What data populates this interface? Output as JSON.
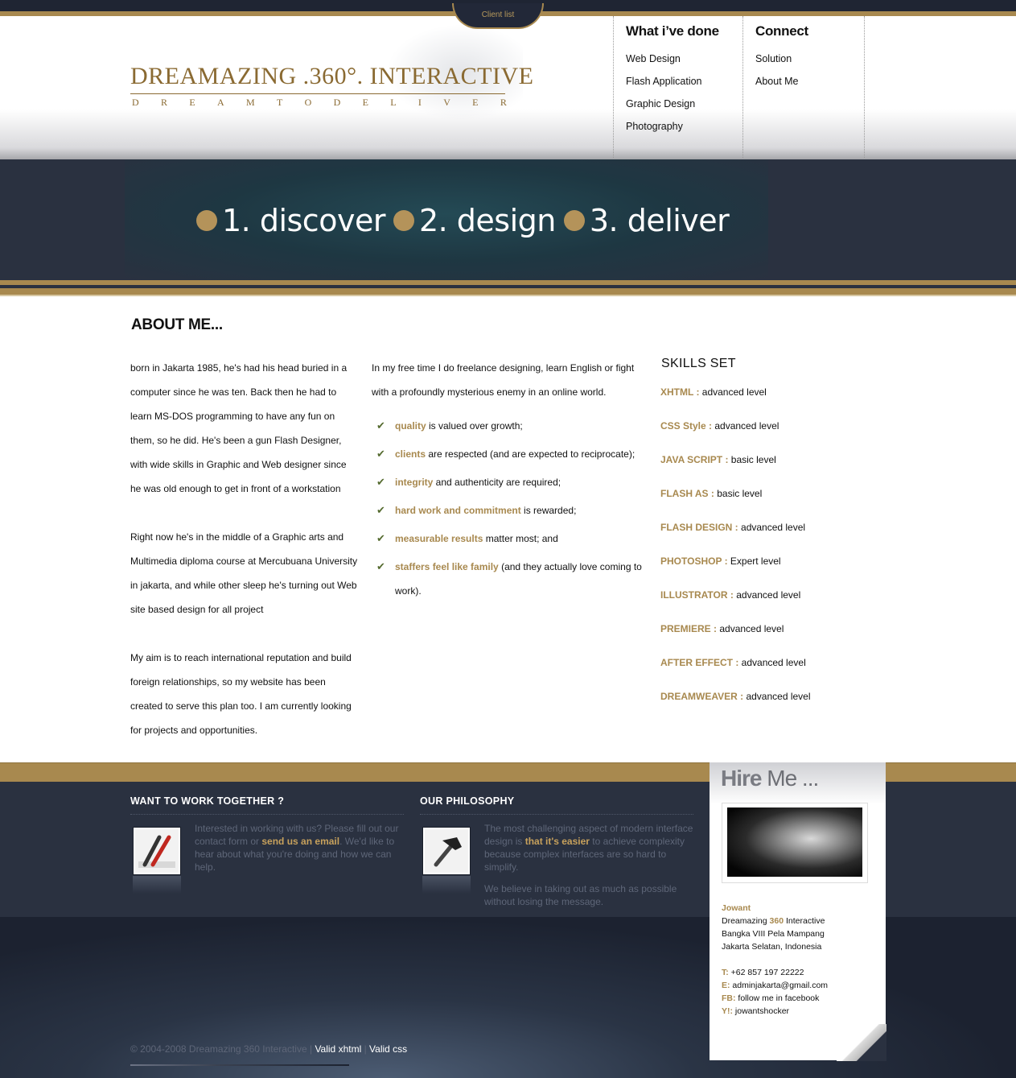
{
  "top": {
    "client_tab": "Client list"
  },
  "logo": {
    "title": "DREAMAZING .360°. INTERACTIVE",
    "tagline": [
      "D",
      "R",
      "E",
      "A",
      "M",
      "T",
      "O",
      "D",
      "E",
      "L",
      "I",
      "V",
      "E",
      "R"
    ],
    "tagline_words": [
      "DREAM",
      "TO",
      "DELIVER"
    ]
  },
  "nav": {
    "col1": {
      "heading": "What i’ve done",
      "items": [
        "Web Design",
        "Flash Application",
        "Graphic Design",
        "Photography"
      ]
    },
    "col2": {
      "heading": "Connect",
      "items": [
        "Solution",
        "About Me"
      ]
    }
  },
  "banner": {
    "steps": [
      "1.  discover",
      "2.  design",
      "3.  deliver"
    ]
  },
  "about": {
    "title": "ABOUT ME...",
    "bio": [
      "born in Jakarta 1985, he's had his head buried in a computer since he was ten. Back then he had to learn MS-DOS programming to have any fun on them, so he did. He's been a gun Flash Designer, with wide skills in Graphic and Web designer since he was old enough to get in front of a workstation",
      "Right now he's in the middle of a Graphic arts and Multimedia diploma course at Mercubuana University in jakarta, and while other sleep he's turning out Web site based design for all project",
      "My aim is to reach international reputation and build foreign relationships, so my website has been created to serve this plan too. I am currently looking for projects and opportunities."
    ],
    "intro": "In my free time I do freelance designing, learn English or fight with a profoundly mysterious enemy in an online world.",
    "values": [
      {
        "key": "quality",
        "rest": " is valued over growth;"
      },
      {
        "key": "clients",
        "rest": " are respected (and are expected to reciprocate);"
      },
      {
        "key": "integrity",
        "rest": " and authenticity are required;"
      },
      {
        "key": "hard work and commitment",
        "rest": " is rewarded;"
      },
      {
        "key": "measurable results",
        "rest": " matter most; and"
      },
      {
        "key": "staffers feel like family",
        "rest": " (and they actually love coming to work)."
      }
    ]
  },
  "skills": {
    "title": "SKILLS SET",
    "items": [
      {
        "name": "XHTML : ",
        "level": "advanced level"
      },
      {
        "name": "CSS Style : ",
        "level": "advanced level"
      },
      {
        "name": "JAVA SCRIPT : ",
        "level": "basic level"
      },
      {
        "name": "FLASH AS : ",
        "level": "basic level"
      },
      {
        "name": "FLASH DESIGN : ",
        "level": "advanced level"
      },
      {
        "name": "PHOTOSHOP : ",
        "level": "Expert level"
      },
      {
        "name": "ILLUSTRATOR : ",
        "level": "advanced level"
      },
      {
        "name": "PREMIERE : ",
        "level": "advanced level"
      },
      {
        "name": "AFTER EFFECT : ",
        "level": "advanced level"
      },
      {
        "name": "DREAMWEAVER : ",
        "level": "advanced level"
      }
    ]
  },
  "footer": {
    "work": {
      "heading": "WANT TO WORK TOGETHER ?",
      "text_before": "Interested in working with us? Please fill out our contact form or ",
      "link": "send us an email",
      "text_after": ". We'd like to hear about what you're doing and how we can help."
    },
    "philosophy": {
      "heading": "OUR PHILOSOPHY",
      "text_before": "The most challenging aspect of modern interface design is ",
      "link": "that it's easier",
      "text_after": " to achieve complexity because complex interfaces are so hard to simplify.",
      "text2": "We believe in taking out as much as possible without losing the message."
    },
    "copyright": "© 2004-2008 Dreamazing 360 Interactive",
    "sep": " | ",
    "valid_xhtml": "Valid xhtml",
    "valid_css": "Valid css"
  },
  "card": {
    "hire_a": "Hire",
    "hire_b": " Me ...",
    "name": "Jowant",
    "company_a": "Dreamazing ",
    "company_num": "360",
    "company_b": " Interactive",
    "address1": "Bangka VIII Pela Mampang",
    "address2": "Jakarta Selatan, Indonesia",
    "phone_label": "T:",
    "phone": " +62 857 197 22222",
    "email_label": "E:",
    "email": " adminjakarta@gmail.com",
    "fb_label": "FB:",
    "fb": " follow me in facebook",
    "y_label": "Y!:",
    "y": " jowantshocker"
  },
  "colors": {
    "gold": "#a8894f",
    "navy": "#2a3140",
    "logo": "#8a6a32"
  }
}
